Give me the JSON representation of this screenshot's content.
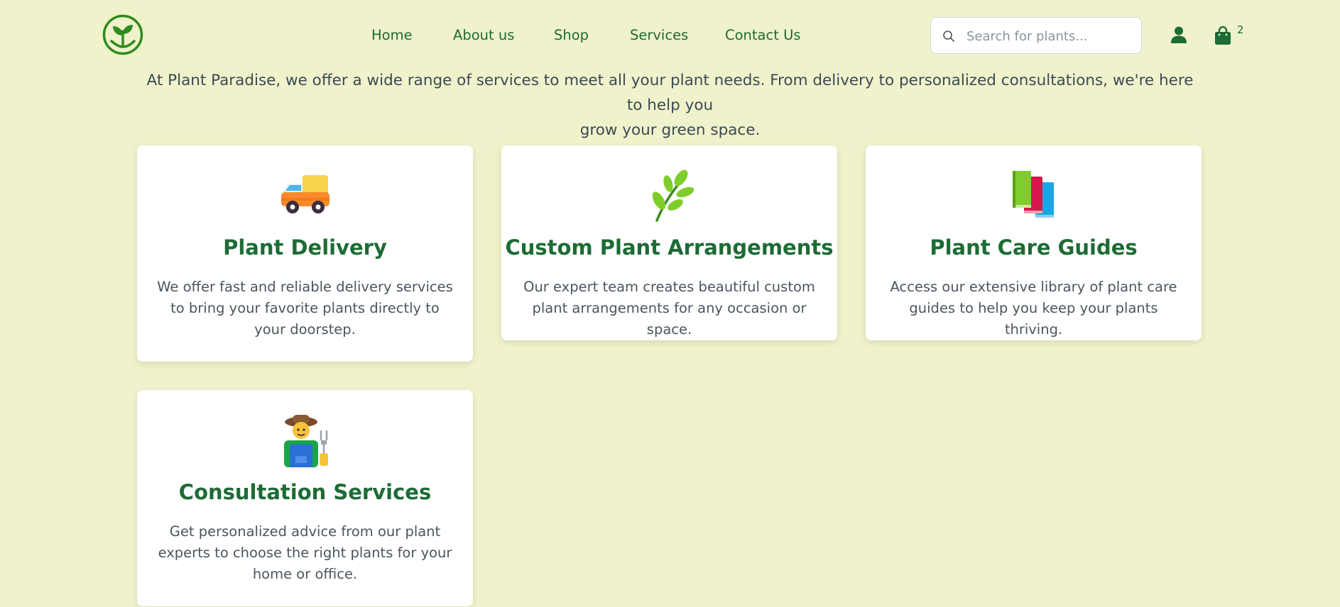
{
  "nav": {
    "links": [
      "Home",
      "About us",
      "Shop",
      "Services",
      "Contact Us"
    ],
    "search_placeholder": "Search for plants...",
    "cart_count": "2"
  },
  "intro": {
    "line1": "At Plant Paradise, we offer a wide range of services to meet all your plant needs. From delivery to personalized consultations, we're here to help you",
    "line2": "grow your green space."
  },
  "services": [
    {
      "icon": "delivery-truck-icon",
      "title": "Plant Delivery",
      "description": "We offer fast and reliable delivery services to bring your favorite plants directly to your doorstep."
    },
    {
      "icon": "herb-icon",
      "title": "Custom Plant Arrangements",
      "description": "Our expert team creates beautiful custom plant arrangements for any occasion or space."
    },
    {
      "icon": "books-icon",
      "title": "Plant Care Guides",
      "description": "Access our extensive library of plant care guides to help you keep your plants thriving."
    },
    {
      "icon": "farmer-icon",
      "title": "Consultation Services",
      "description": "Get personalized advice from our plant experts to choose the right plants for your home or office."
    }
  ],
  "colors": {
    "background": "#f0f2cb",
    "primary_green": "#1d6b35",
    "card_background": "#ffffff"
  }
}
